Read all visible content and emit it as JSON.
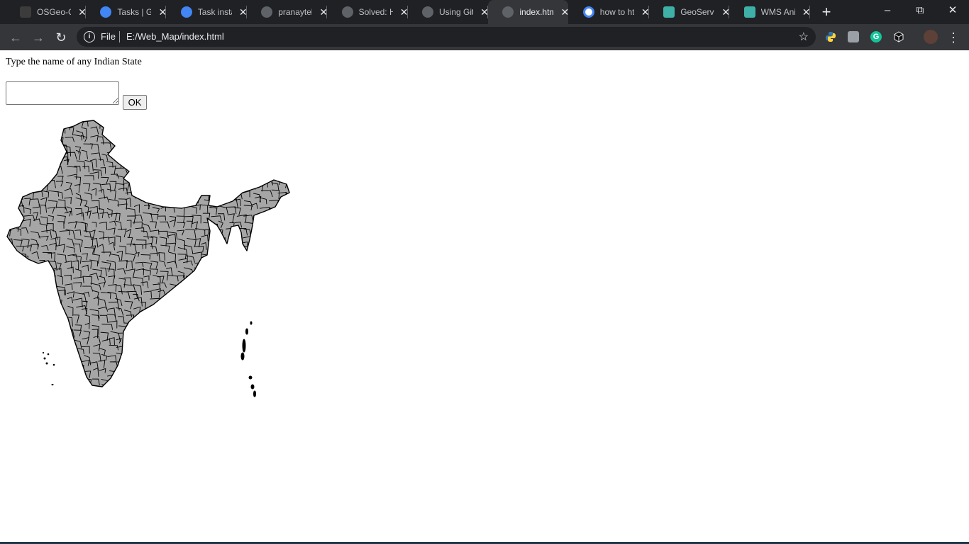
{
  "browser": {
    "tabs": [
      {
        "title": "OSGeo-G",
        "icon": "osgeo-favicon"
      },
      {
        "title": "Tasks | Go",
        "icon": "gear-favicon"
      },
      {
        "title": "Task insta",
        "icon": "gear-favicon"
      },
      {
        "title": "pranaytek",
        "icon": "github-favicon"
      },
      {
        "title": "Solved: H",
        "icon": "github-favicon"
      },
      {
        "title": "Using Git",
        "icon": "github-favicon"
      },
      {
        "title": "index.htm",
        "icon": "globe-favicon",
        "active": true
      },
      {
        "title": "how to ht",
        "icon": "google-favicon"
      },
      {
        "title": "GeoServe",
        "icon": "geoserver-favicon"
      },
      {
        "title": "WMS Ani",
        "icon": "geoserver-favicon"
      }
    ],
    "close_glyph": "✕",
    "new_tab_glyph": "+",
    "scheme_label": "File",
    "url": "E:/Web_Map/index.html"
  },
  "page": {
    "prompt": "Type the name of any Indian State",
    "input_value": "",
    "ok_label": "OK"
  },
  "colors": {
    "tabstrip": "#202124",
    "toolbar": "#35363a",
    "map_fill": "#a6a6a6",
    "map_stroke": "#000000"
  }
}
